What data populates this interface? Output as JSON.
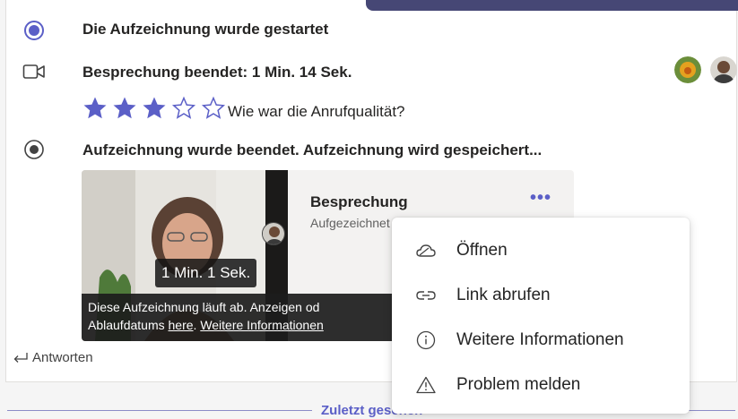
{
  "events": {
    "recording_started": "Die Aufzeichnung wurde gestartet",
    "meeting_ended": "Besprechung beendet: 1 Min. 14 Sek.",
    "rating_question": "Wie war die Anrufqualität?",
    "rating_stars": 3,
    "rating_max": 5,
    "recording_ended": "Aufzeichnung wurde beendet. Aufzeichnung wird gespeichert..."
  },
  "recording_card": {
    "title": "Besprechung",
    "subtitle": "Aufgezeichnet",
    "duration": "1 Min. 1 Sek.",
    "more_label": "•••",
    "expire_line1": "Diese Aufzeichnung läuft ab. Anzeigen od",
    "expire_line2_prefix": "Ablaufdatums ",
    "expire_link_here": "here",
    "expire_sep": ". ",
    "expire_link_more": "Weitere Informationen"
  },
  "reply_label": "Antworten",
  "recently_seen": "Zuletzt gesehen",
  "context_menu": {
    "items": [
      {
        "label": "Öffnen",
        "icon": "cloud-icon"
      },
      {
        "label": "Link abrufen",
        "icon": "link-icon"
      },
      {
        "label": "Weitere Informationen",
        "icon": "info-icon"
      },
      {
        "label": "Problem melden",
        "icon": "warning-icon"
      }
    ]
  },
  "colors": {
    "accent": "#5b5fc7",
    "header_bar": "#464775",
    "star_fill": "#5b5fc7"
  }
}
